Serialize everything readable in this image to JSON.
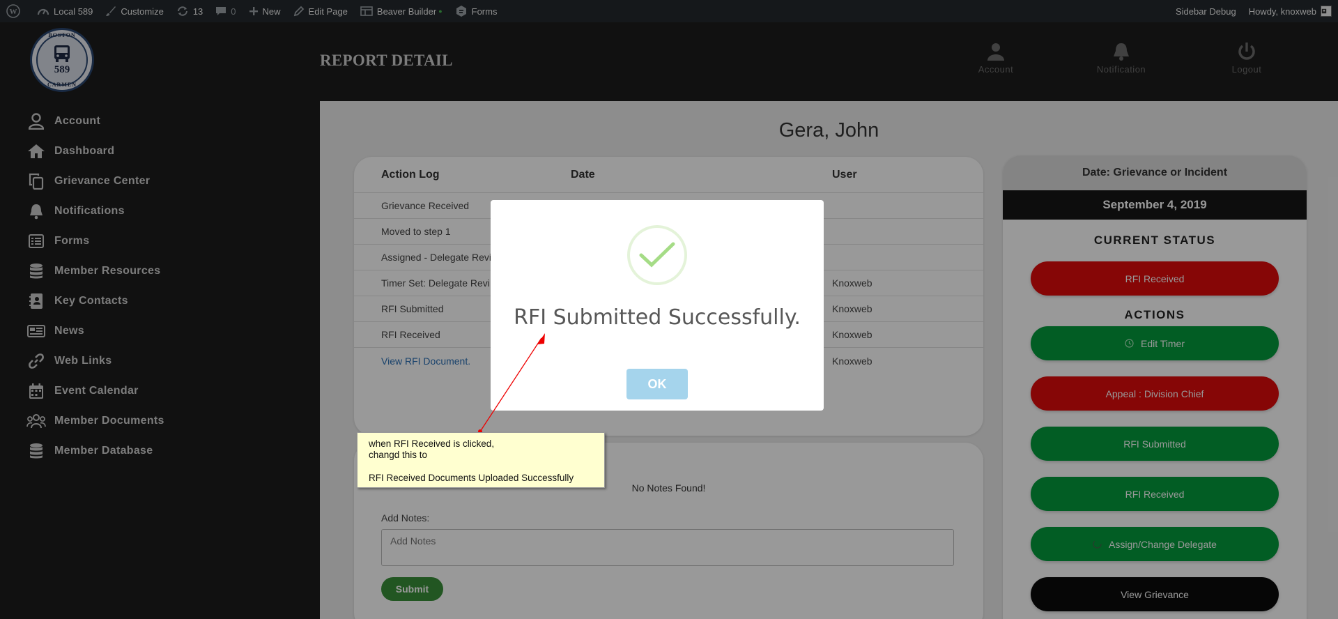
{
  "adminbar": {
    "site": "Local 589",
    "customize": "Customize",
    "updates": "13",
    "comments": "0",
    "new": "New",
    "edit_page": "Edit Page",
    "beaver_builder": "Beaver Builder",
    "beaver_dot": "●",
    "forms": "Forms",
    "sidebar_debug": "Sidebar Debug",
    "howdy": "Howdy, knoxweb"
  },
  "sidebar": {
    "logo": {
      "top": "BOSTON",
      "number": "589",
      "bottom": "CARMEN"
    },
    "items": [
      {
        "label": "Account",
        "icon": "user-icon"
      },
      {
        "label": "Dashboard",
        "icon": "home-icon"
      },
      {
        "label": "Grievance Center",
        "icon": "copy-icon"
      },
      {
        "label": "Notifications",
        "icon": "bell-icon"
      },
      {
        "label": "Forms",
        "icon": "form-icon"
      },
      {
        "label": "Member Resources",
        "icon": "database-icon"
      },
      {
        "label": "Key Contacts",
        "icon": "contact-book-icon"
      },
      {
        "label": "News",
        "icon": "newspaper-icon"
      },
      {
        "label": "Web Links",
        "icon": "link-icon"
      },
      {
        "label": "Event Calendar",
        "icon": "calendar-icon"
      },
      {
        "label": "Member Documents",
        "icon": "users-icon"
      },
      {
        "label": "Member Database",
        "icon": "database-icon"
      }
    ]
  },
  "header": {
    "title": "REPORT DETAIL",
    "account": "Account",
    "notification": "Notification",
    "logout": "Logout"
  },
  "main": {
    "person_name": "Gera, John",
    "action_log": {
      "headers": [
        "Action Log",
        "Date",
        "User"
      ],
      "rows": [
        {
          "action": "Grievance Received",
          "date": "",
          "user": ""
        },
        {
          "action": "Moved to step 1",
          "date": "",
          "user": ""
        },
        {
          "action": "Assigned - Delegate Revi",
          "date": "",
          "user": ""
        },
        {
          "action": "Timer Set: Delegate Revi",
          "date": "",
          "user": "Knoxweb"
        },
        {
          "action": "RFI Submitted",
          "date": "",
          "user": "Knoxweb"
        },
        {
          "action": "RFI Received",
          "date": "",
          "user": "Knoxweb"
        },
        {
          "action": "View RFI Document.",
          "date": "",
          "user": "Knoxweb"
        }
      ]
    },
    "notes": {
      "empty": "No Notes Found!",
      "add_label": "Add Notes:",
      "placeholder": "Add Notes",
      "submit": "Submit"
    },
    "status": {
      "date_label": "Date: Grievance or Incident",
      "date": "September 4, 2019",
      "current_status_title": "CURRENT STATUS",
      "current_status": "RFI Received",
      "actions_title": "ACTIONS",
      "actions": [
        {
          "label": "Edit Timer",
          "color": "#049c3c",
          "icon": "clock-icon"
        },
        {
          "label": "Appeal : Division Chief",
          "color": "#e00a0a"
        },
        {
          "label": "RFI Submitted",
          "color": "#049c3c"
        },
        {
          "label": "RFI Received",
          "color": "#049c3c"
        },
        {
          "label": "Assign/Change Delegate",
          "color": "#049c3c",
          "icon": "spinner-icon"
        },
        {
          "label": "View Grievance",
          "color": "#0a0a0a"
        }
      ]
    }
  },
  "modal": {
    "title": "RFI Submitted Successfully.",
    "ok": "OK"
  },
  "annotation": {
    "line1": "when RFI Received is clicked,",
    "line2": "changd this to",
    "line3": "RFI Received Documents Uploaded Successfully"
  },
  "colors": {
    "accent_green": "#049c3c",
    "accent_red": "#e00a0a",
    "sidebar_bg": "#1d1d1d",
    "adminbar_bg": "#23282d"
  }
}
